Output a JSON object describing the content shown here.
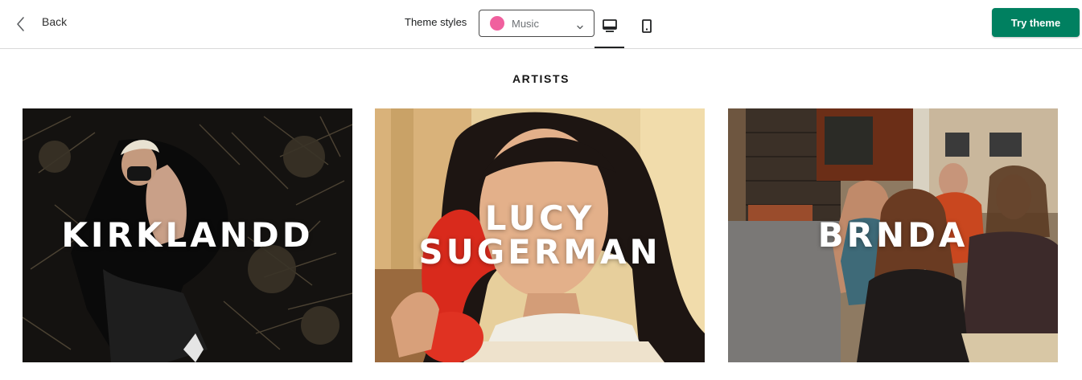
{
  "header": {
    "back_label": "Back",
    "theme_styles_label": "Theme styles",
    "theme_select": {
      "value": "Music",
      "swatch_color": "#f0609e"
    },
    "view_modes": [
      {
        "name": "desktop",
        "selected": true
      },
      {
        "name": "mobile",
        "selected": false
      }
    ],
    "try_theme_label": "Try theme",
    "accent_color": "#008060"
  },
  "section": {
    "title": "ARTISTS",
    "artists": [
      {
        "name": "KIRKLANDD"
      },
      {
        "name": "LUCY SUGERMAN"
      },
      {
        "name": "BRNDA"
      }
    ]
  }
}
